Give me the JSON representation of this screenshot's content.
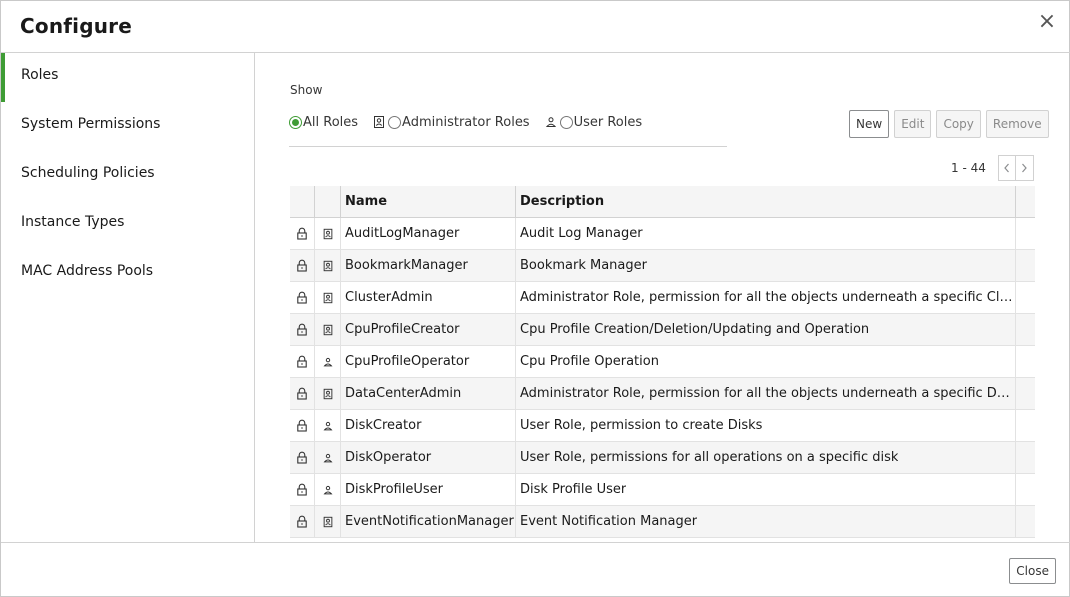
{
  "dialog": {
    "title": "Configure",
    "close_symbol": "×"
  },
  "sidebar": {
    "items": [
      {
        "label": "Roles",
        "active": true
      },
      {
        "label": "System Permissions"
      },
      {
        "label": "Scheduling Policies"
      },
      {
        "label": "Instance Types"
      },
      {
        "label": "MAC Address Pools"
      }
    ]
  },
  "filter": {
    "show_label": "Show",
    "options": [
      {
        "label": "All Roles",
        "checked": true
      },
      {
        "label": "Administrator Roles",
        "icon": "admin-role-icon"
      },
      {
        "label": "User Roles",
        "icon": "user-role-icon"
      }
    ]
  },
  "toolbar": {
    "new_label": "New",
    "edit_label": "Edit",
    "copy_label": "Copy",
    "remove_label": "Remove"
  },
  "pager": {
    "range": "1 - 44",
    "prev_icon": "chevron-left-icon",
    "next_icon": "chevron-right-icon"
  },
  "table": {
    "headers": {
      "name": "Name",
      "description": "Description"
    },
    "rows": [
      {
        "type": "admin",
        "name": "AuditLogManager",
        "description": "Audit Log Manager"
      },
      {
        "type": "admin",
        "name": "BookmarkManager",
        "description": "Bookmark Manager"
      },
      {
        "type": "admin",
        "name": "ClusterAdmin",
        "description": "Administrator Role, permission for all the objects underneath a specific Cluster"
      },
      {
        "type": "admin",
        "name": "CpuProfileCreator",
        "description": "Cpu Profile Creation/Deletion/Updating and Operation"
      },
      {
        "type": "user",
        "name": "CpuProfileOperator",
        "description": "Cpu Profile Operation"
      },
      {
        "type": "admin",
        "name": "DataCenterAdmin",
        "description": "Administrator Role, permission for all the objects underneath a specific Data Ce..."
      },
      {
        "type": "user",
        "name": "DiskCreator",
        "description": "User Role, permission to create Disks"
      },
      {
        "type": "user",
        "name": "DiskOperator",
        "description": "User Role, permissions for all operations on a specific disk"
      },
      {
        "type": "user",
        "name": "DiskProfileUser",
        "description": "Disk Profile User"
      },
      {
        "type": "admin",
        "name": "EventNotificationManager",
        "description": "Event Notification Manager"
      }
    ]
  },
  "footer": {
    "close_label": "Close"
  },
  "colors": {
    "accent": "#3f9c35",
    "border": "#d2d2d2",
    "row_alt": "#f5f5f5"
  }
}
